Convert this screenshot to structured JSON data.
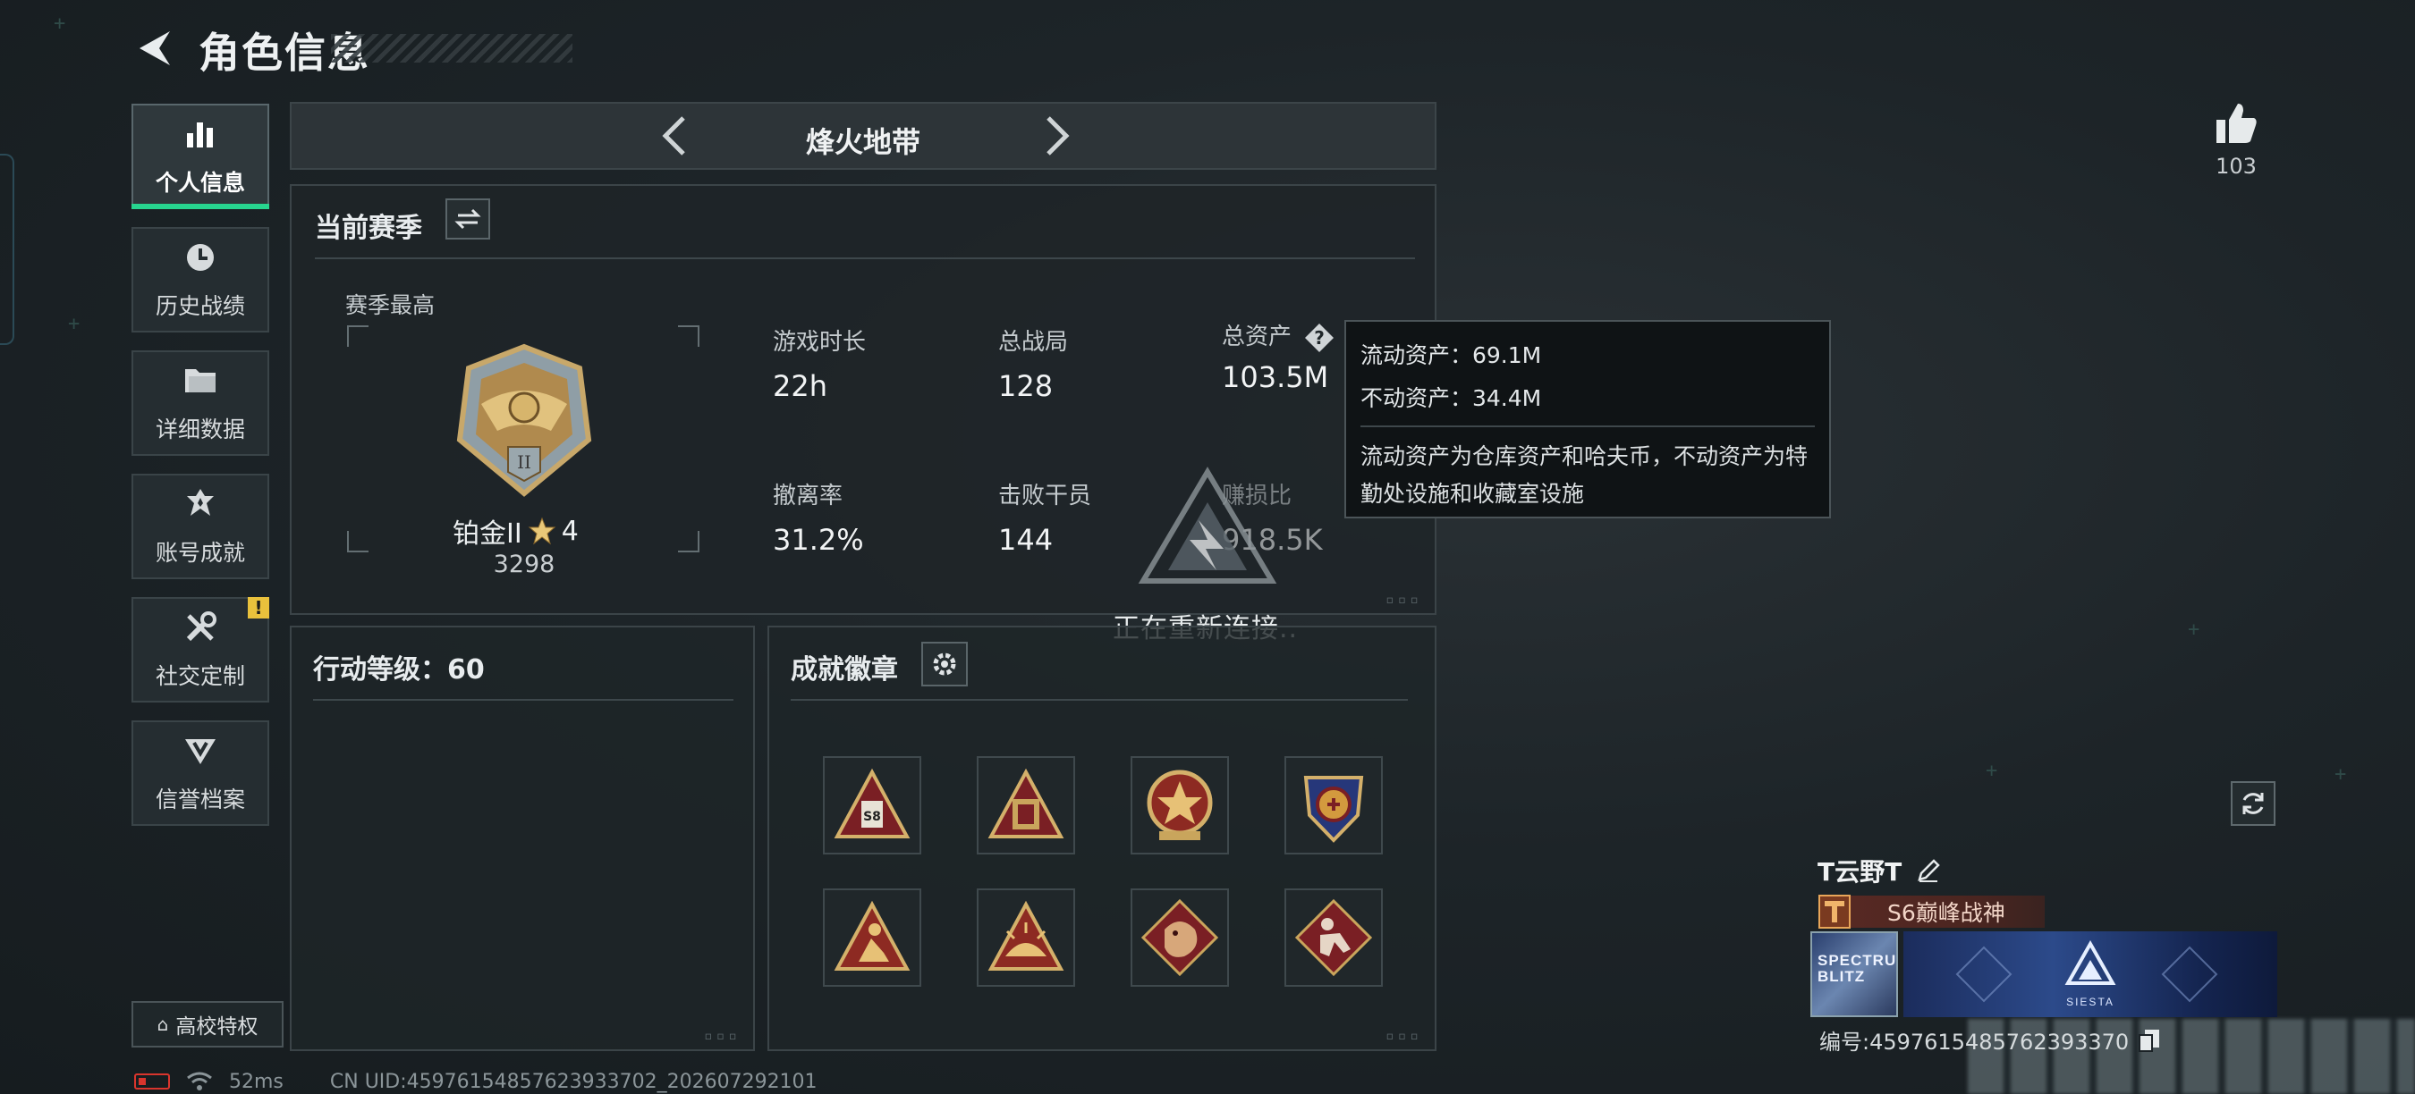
{
  "header": {
    "back_icon": "back-arrow-icon",
    "title": "角色信息"
  },
  "sidebar": {
    "items": [
      {
        "label": "个人信息",
        "icon": "bar-chart-icon",
        "active": true
      },
      {
        "label": "历史战绩",
        "icon": "history-clock-icon",
        "active": false
      },
      {
        "label": "详细数据",
        "icon": "folder-icon",
        "active": false
      },
      {
        "label": "账号成就",
        "icon": "achievement-icon",
        "active": false
      },
      {
        "label": "社交定制",
        "icon": "tools-icon",
        "active": false,
        "badge": "!"
      },
      {
        "label": "信誉档案",
        "icon": "credit-shield-icon",
        "active": false
      }
    ],
    "campus_button": "高校特权"
  },
  "mode": {
    "name": "烽火地带"
  },
  "season": {
    "title": "当前赛季",
    "highest_label": "赛季最高",
    "rank_name": "铂金II",
    "rank_stars": "4",
    "rank_score": "3298",
    "stats": [
      {
        "label": "游戏时长",
        "value": "22h"
      },
      {
        "label": "总战局",
        "value": "128"
      },
      {
        "label": "总资产",
        "value": "103.5M"
      },
      {
        "label": "撤离率",
        "value": "31.2%"
      },
      {
        "label": "击败干员",
        "value": "144"
      },
      {
        "label": "赚损比",
        "value": "918.5K"
      }
    ]
  },
  "tooltip": {
    "liquid": "流动资产：69.1M",
    "fixed": "不动资产：34.4M",
    "desc": "流动资产为仓库资产和哈夫币，不动资产为特勤处设施和收藏室设施"
  },
  "reconnect": {
    "text": "正在重新连接.."
  },
  "level": {
    "title": "行动等级：60"
  },
  "badges": {
    "title": "成就徽章",
    "items": [
      "s8-triangle-badge",
      "gold-triangle-badge",
      "star-medal-badge",
      "blue-crest-badge",
      "runner-triangle-badge",
      "sunrise-triangle-badge",
      "dragon-diamond-badge",
      "runner-diamond-badge"
    ]
  },
  "profile": {
    "likes": "103",
    "name": "T云野T",
    "title_badge": "S6巅峰战神",
    "card_thumb_text": "SPECTRUM BLITZ",
    "card_banner_text": "SIESTA",
    "id_label": "编号:4597615485762393370"
  },
  "status": {
    "ping": "52ms",
    "uid": "CN UID:45976154857623933702_202607292101"
  },
  "colors": {
    "accent_green": "#27d58f",
    "warning": "#e9c13c",
    "battery_low": "#d9352d"
  }
}
